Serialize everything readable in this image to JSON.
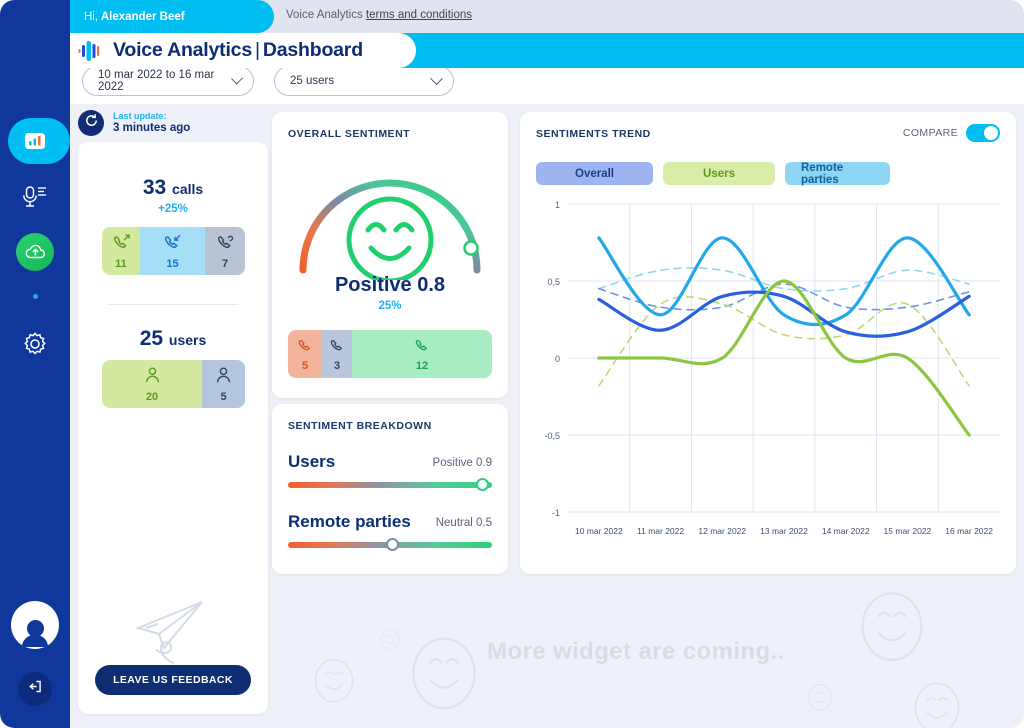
{
  "topbar": {
    "greeting_prefix": "Hi,",
    "user_name": "Alexander Beef",
    "terms_prefix": "Voice Analytics ",
    "terms_link": "terms and conditions"
  },
  "titlebar": {
    "app_name": "Voice Analytics",
    "separator": "|",
    "page_name": "Dashboard"
  },
  "filters": {
    "date_range": "10 mar 2022 to 16 mar 2022",
    "users": "25 users"
  },
  "last_update": {
    "label": "Last update:",
    "value": "3 minutes ago"
  },
  "stats": {
    "calls_value": "33",
    "calls_unit": "calls",
    "calls_delta": "+25%",
    "call_types": [
      {
        "name": "outgoing",
        "count": "11"
      },
      {
        "name": "incoming",
        "count": "15"
      },
      {
        "name": "missed",
        "count": "7"
      }
    ],
    "users_value": "25",
    "users_unit": "users",
    "user_types": [
      {
        "name": "active",
        "count": "20"
      },
      {
        "name": "inactive",
        "count": "5"
      }
    ],
    "feedback_button": "LEAVE US FEEDBACK"
  },
  "overall_sentiment": {
    "title": "OVERALL SENTIMENT",
    "label": "Positive 0.8",
    "percent": "25%",
    "gauge_value": 0.8,
    "segments": [
      {
        "name": "negative",
        "count": "5"
      },
      {
        "name": "neutral",
        "count": "3"
      },
      {
        "name": "positive",
        "count": "12"
      }
    ]
  },
  "sentiment_breakdown": {
    "title": "SENTIMENT BREAKDOWN",
    "rows": [
      {
        "name": "Users",
        "value": "Positive 0.9",
        "pos": 0.95
      },
      {
        "name": "Remote parties",
        "value": "Neutral 0.5",
        "pos": 0.5
      }
    ]
  },
  "trend": {
    "title": "SENTIMENTS TREND",
    "compare_label": "COMPARE",
    "compare_on": true,
    "legend": [
      {
        "label": "Overall",
        "color": "#9db4f0"
      },
      {
        "label": "Users",
        "color": "#d9eda7"
      },
      {
        "label": "Remote parties",
        "color": "#8fd6f5"
      }
    ]
  },
  "chart_data": {
    "type": "line",
    "title": "SENTIMENTS TREND",
    "xlabel": "",
    "ylabel": "",
    "ylim": [
      -1,
      1
    ],
    "yticks": [
      "1",
      "0,5",
      "0",
      "-0,5",
      "-1"
    ],
    "ytick_values": [
      1,
      0.5,
      0,
      -0.5,
      -1
    ],
    "categories": [
      "10 mar 2022",
      "11 mar 2022",
      "12 mar 2022",
      "13 mar 2022",
      "14 mar 2022",
      "15 mar 2022",
      "16 mar 2022"
    ],
    "grid": true,
    "legend_position": "top-left",
    "series": [
      {
        "name": "Remote parties",
        "style": "solid",
        "color": "#22a7e8",
        "values": [
          0.78,
          0.28,
          0.78,
          0.28,
          0.28,
          0.78,
          0.28
        ]
      },
      {
        "name": "Overall",
        "style": "solid",
        "color": "#2a5fe0",
        "values": [
          0.38,
          0.18,
          0.4,
          0.4,
          0.17,
          0.17,
          0.4
        ]
      },
      {
        "name": "Users",
        "style": "solid",
        "color": "#8cc63f",
        "values": [
          0.0,
          0.0,
          0.0,
          0.5,
          0.0,
          0.0,
          -0.5
        ]
      },
      {
        "name": "Remote parties (compare)",
        "style": "dashed",
        "color": "#8fd6f5",
        "values": [
          0.45,
          0.57,
          0.57,
          0.45,
          0.45,
          0.57,
          0.48
        ]
      },
      {
        "name": "Overall (compare)",
        "style": "dashed",
        "color": "#6f93e8",
        "values": [
          0.45,
          0.33,
          0.33,
          0.48,
          0.33,
          0.33,
          0.43
        ]
      },
      {
        "name": "Users (compare)",
        "style": "dashed",
        "color": "#bcd97a",
        "values": [
          -0.18,
          0.35,
          0.35,
          0.15,
          0.15,
          0.35,
          -0.18
        ]
      }
    ]
  },
  "coming_soon": {
    "text": "More widget are coming.."
  },
  "colors": {
    "accent_cyan": "#00bdf2",
    "navy": "#0f2d72",
    "sidebar": "#10379b",
    "green": "#8cc63f",
    "canvas": "#eef1f7"
  }
}
